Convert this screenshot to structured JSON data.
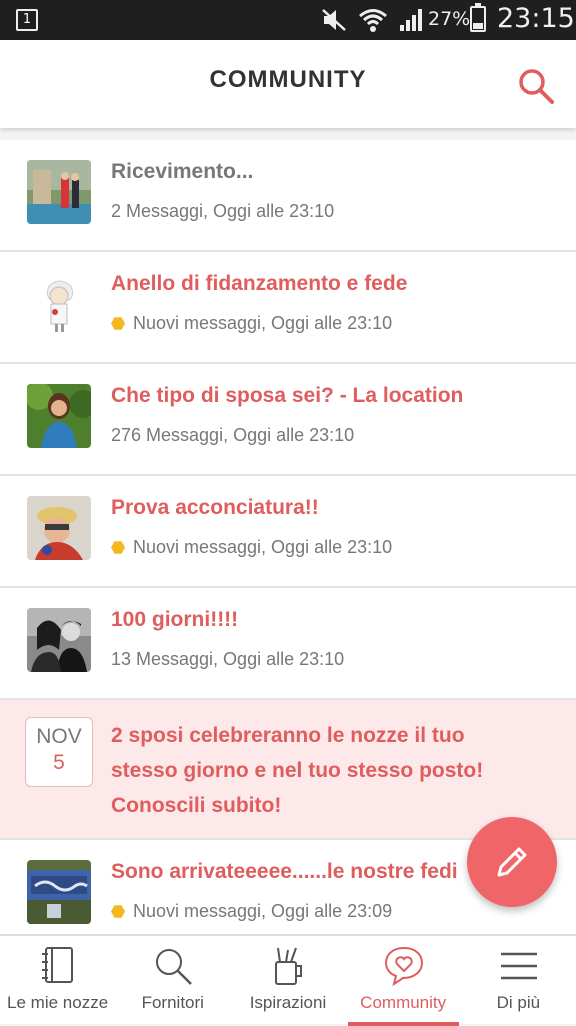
{
  "statusbar": {
    "notification_digit": "1",
    "battery": "27%",
    "battery_level": 0.27,
    "time": "23:15"
  },
  "header": {
    "title": "COMMUNITY"
  },
  "threads": [
    {
      "title": "Ricevimento...",
      "meta": "2 Messaggi, Oggi alle 23:10",
      "unread": false
    },
    {
      "title": "Anello di fidanzamento e fede",
      "meta": "Nuovi messaggi, Oggi alle 23:10",
      "unread": true
    },
    {
      "title": "Che tipo di sposa sei? - La location",
      "meta": "276 Messaggi, Oggi alle 23:10",
      "unread": false
    },
    {
      "title": "Prova acconciatura!!",
      "meta": "Nuovi messaggi, Oggi alle 23:10",
      "unread": true
    },
    {
      "title": "100 giorni!!!!",
      "meta": "13 Messaggi, Oggi alle 23:10",
      "unread": false
    },
    {
      "title": "Sono arrivateeeee......le nostre fedi",
      "meta": "Nuovi messaggi, Oggi alle 23:09",
      "unread": true
    }
  ],
  "promo": {
    "month": "NOV",
    "day": "5",
    "text": "2 sposi celebreranno le nozze il tuo stesso giorno e nel tuo stesso posto! Conoscili subito!"
  },
  "nav": [
    {
      "label": "Le mie nozze",
      "icon": "notebook-icon"
    },
    {
      "label": "Fornitori",
      "icon": "search-icon"
    },
    {
      "label": "Ispirazioni",
      "icon": "pencil-cup-icon"
    },
    {
      "label": "Community",
      "icon": "heart-chat-icon",
      "active": true
    },
    {
      "label": "Di più",
      "icon": "menu-icon"
    }
  ],
  "colors": {
    "accent": "#e05d5d",
    "fab": "#f06567",
    "promo_bg": "#fde9e9",
    "badge": "#f4b71d"
  }
}
